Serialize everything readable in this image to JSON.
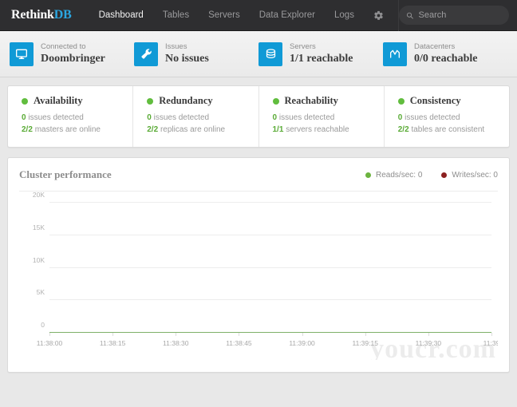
{
  "navbar": {
    "logo_primary": "Rethink",
    "logo_accent": "DB",
    "links": [
      {
        "label": "Dashboard",
        "active": true
      },
      {
        "label": "Tables",
        "active": false
      },
      {
        "label": "Servers",
        "active": false
      },
      {
        "label": "Data Explorer",
        "active": false
      },
      {
        "label": "Logs",
        "active": false
      }
    ],
    "settings_icon": "gear-icon",
    "search": {
      "placeholder": "Search",
      "value": "",
      "icon": "search-icon"
    },
    "colors": {
      "background": "#2e2e30",
      "accent": "#2ba6e0",
      "active_text": "#f2f2f2",
      "inactive_text": "#9a9a9c"
    }
  },
  "status_strip": {
    "tile_color": "#109ad6",
    "items": [
      {
        "label": "Connected to",
        "value": "Doombringer",
        "icon": "monitor-icon"
      },
      {
        "label": "Issues",
        "value": "No issues",
        "icon": "wrench-icon"
      },
      {
        "label": "Servers",
        "value": "1/1 reachable",
        "icon": "database-icon"
      },
      {
        "label": "Datacenters",
        "value": "0/0 reachable",
        "icon": "datacenter-icon"
      }
    ]
  },
  "status_cards": {
    "dot_color": "#61bd3e",
    "items": [
      {
        "title": "Availability",
        "line1_value": "0",
        "line1_text": "issues detected",
        "line2_value": "2/2",
        "line2_text": "masters are online"
      },
      {
        "title": "Redundancy",
        "line1_value": "0",
        "line1_text": "issues detected",
        "line2_value": "2/2",
        "line2_text": "replicas are online"
      },
      {
        "title": "Reachability",
        "line1_value": "0",
        "line1_text": "issues detected",
        "line2_value": "1/1",
        "line2_text": "servers reachable"
      },
      {
        "title": "Consistency",
        "line1_value": "0",
        "line1_text": "issues detected",
        "line2_value": "2/2",
        "line2_text": "tables are consistent"
      }
    ]
  },
  "chart_panel": {
    "title": "Cluster performance",
    "legend": [
      {
        "label": "Reads/sec: 0",
        "color": "#6cb33f"
      },
      {
        "label": "Writes/sec: 0",
        "color": "#8c2020"
      }
    ],
    "watermark": "youcr.com"
  },
  "chart_data": {
    "type": "line",
    "title": "Cluster performance",
    "xlabel": "",
    "ylabel": "",
    "ylim": [
      0,
      20000
    ],
    "ytick_labels": [
      "0",
      "5K",
      "10K",
      "15K",
      "20K"
    ],
    "ytick_values": [
      0,
      5000,
      10000,
      15000,
      20000
    ],
    "grid": true,
    "legend_position": "top-right",
    "x": [
      "11:38:00",
      "11:38:15",
      "11:38:30",
      "11:38:45",
      "11:39:00",
      "11:39:15",
      "11:39:30",
      "11:39"
    ],
    "series": [
      {
        "name": "Reads/sec: 0",
        "color": "#6cb33f",
        "values": [
          0,
          0,
          0,
          0,
          0,
          0,
          0,
          0
        ]
      },
      {
        "name": "Writes/sec: 0",
        "color": "#8c2020",
        "values": [
          0,
          0,
          0,
          0,
          0,
          0,
          0,
          0
        ]
      }
    ]
  }
}
